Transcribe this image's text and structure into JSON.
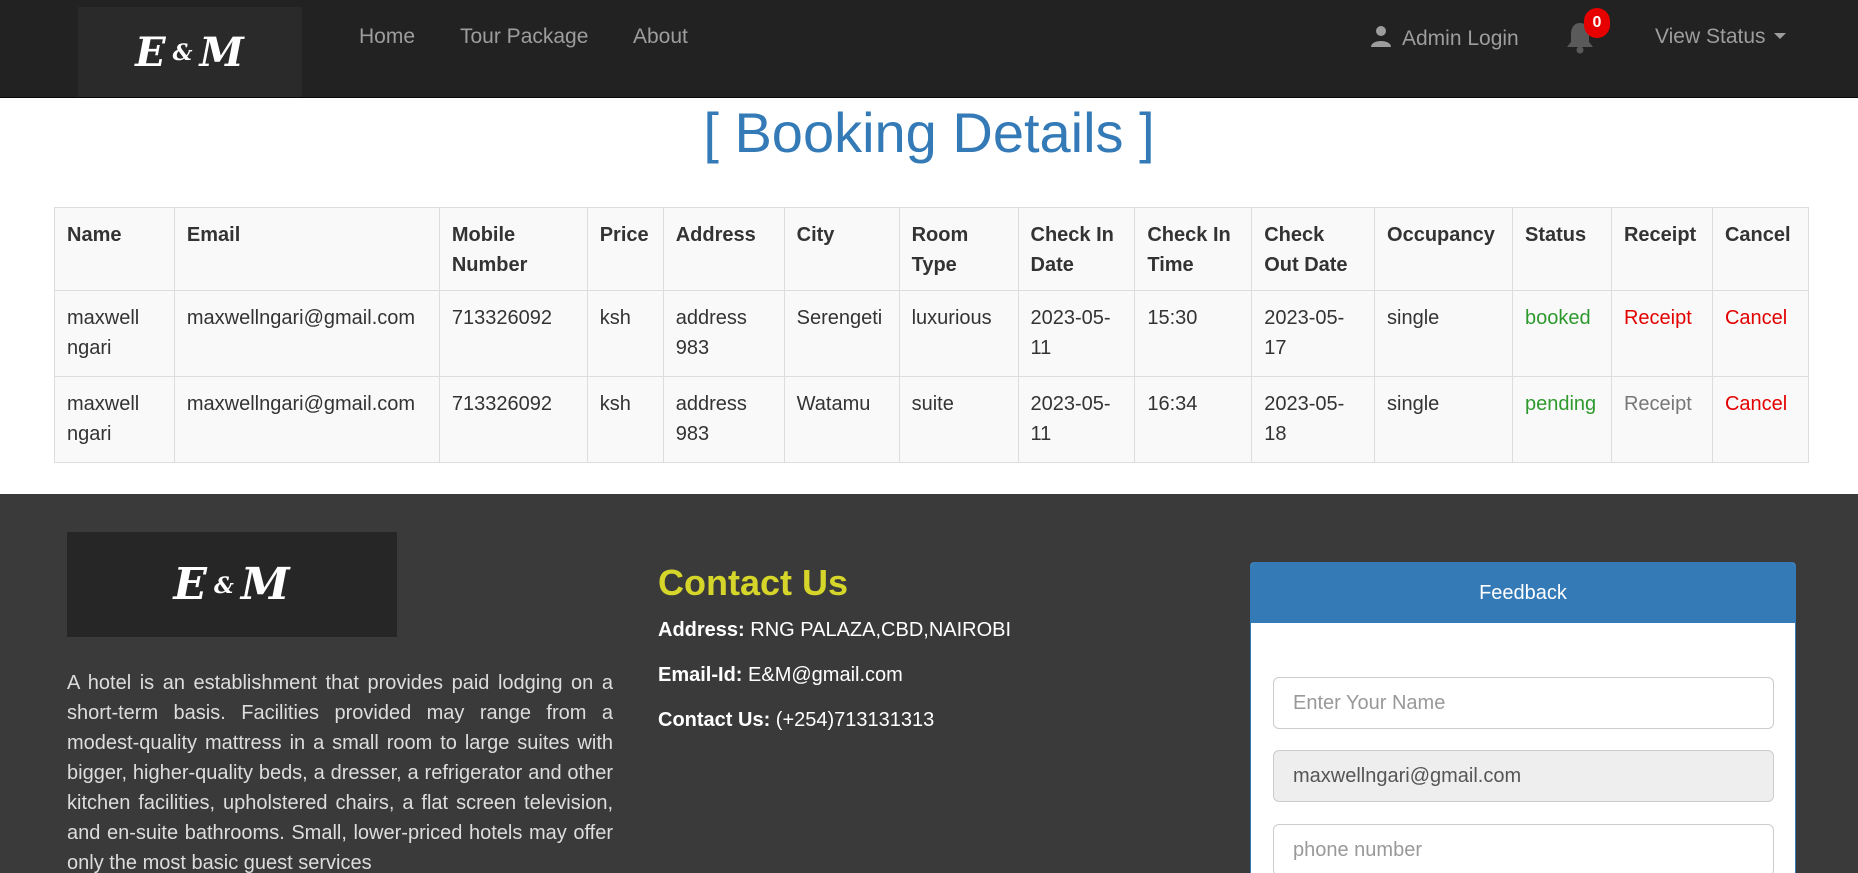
{
  "brand": {
    "logo_left": "E",
    "logo_amp": "&",
    "logo_right": "M"
  },
  "nav": {
    "links": [
      "Home",
      "Tour Package",
      "About"
    ],
    "admin_login": "Admin Login",
    "notification_count": "0",
    "view_status": "View Status"
  },
  "page": {
    "title": "[ Booking Details ]"
  },
  "table": {
    "headers": [
      "Name",
      "Email",
      "Mobile Number",
      "Price",
      "Address",
      "City",
      "Room Type",
      "Check In Date",
      "Check In Time",
      "Check Out Date",
      "Occupancy",
      "Status",
      "Receipt",
      "Cancel"
    ],
    "rows": [
      {
        "name": "maxwell ngari",
        "email": "maxwellngari@gmail.com",
        "mobile": "713326092",
        "price": "ksh",
        "address": "address 983",
        "city": "Serengeti",
        "room_type": "luxurious",
        "check_in_date": "2023-05-11",
        "check_in_time": "15:30",
        "check_out_date": "2023-05-17",
        "occupancy": "single",
        "status": "booked",
        "receipt": "Receipt",
        "cancel": "Cancel"
      },
      {
        "name": "maxwell ngari",
        "email": "maxwellngari@gmail.com",
        "mobile": "713326092",
        "price": "ksh",
        "address": "address 983",
        "city": "Watamu",
        "room_type": "suite",
        "check_in_date": "2023-05-11",
        "check_in_time": "16:34",
        "check_out_date": "2023-05-18",
        "occupancy": "single",
        "status": "pending",
        "receipt": "Receipt",
        "cancel": "Cancel"
      }
    ]
  },
  "footer": {
    "about": "A hotel is an establishment that provides paid lodging on a short-term basis. Facilities provided may range from a modest-quality mattress in a small room to large suites with bigger, higher-quality beds, a dresser, a refrigerator and other kitchen facilities, upholstered chairs, a flat screen television, and en-suite bathrooms. Small, lower-priced hotels may offer only the most basic guest services",
    "contact_title": "Contact Us",
    "address_label": "Address:",
    "address_value": "RNG PALAZA,CBD,NAIROBI",
    "email_label": "Email-Id:",
    "email_value": "E&M@gmail.com",
    "phone_label": "Contact Us:",
    "phone_value": "(+254)713131313"
  },
  "feedback": {
    "title": "Feedback",
    "name_placeholder": "Enter Your Name",
    "email_value": "maxwellngari@gmail.com",
    "phone_placeholder": "phone number"
  },
  "colors": {
    "navbar": "#222222",
    "title_blue": "#337ab7",
    "footer": "#3a3a3a",
    "contact_yellow": "#d6d62a",
    "status_green": "#2e9a2e",
    "link_red": "#e30000",
    "badge_red": "#e60000"
  },
  "icons": [
    "user-icon",
    "bell-icon",
    "caret-down-icon"
  ]
}
